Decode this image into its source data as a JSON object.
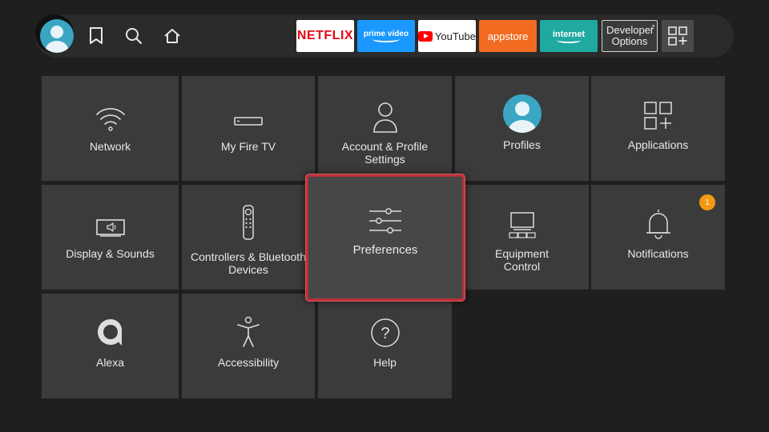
{
  "topbar": {
    "icons": [
      "profile-avatar",
      "bookmark-icon",
      "search-icon",
      "home-icon"
    ],
    "apps": {
      "netflix": "NETFLIX",
      "prime_video": "prime video",
      "youtube": "YouTube",
      "appstore": "appstore",
      "internet": "internet",
      "developer_options": "Developer Options"
    },
    "grid_icon": "apps-grid-icon",
    "settings_icon": "gear-icon"
  },
  "tiles": [
    {
      "label": "Network",
      "icon": "wifi-icon"
    },
    {
      "label": "My Fire TV",
      "icon": "fire-tv-stick-icon"
    },
    {
      "label": "Account & Profile\nSettings",
      "icon": "person-icon"
    },
    {
      "label": "Profiles",
      "icon": "profile-avatar-icon"
    },
    {
      "label": "Applications",
      "icon": "applications-icon"
    },
    {
      "label": "Display & Sounds",
      "icon": "tv-speaker-icon"
    },
    {
      "label": "Controllers & Bluetooth\nDevices",
      "icon": "remote-icon"
    },
    {
      "label": "Preferences",
      "icon": "sliders-icon",
      "focused": true
    },
    {
      "label": "Equipment\nControl",
      "icon": "equipment-icon"
    },
    {
      "label": "Notifications",
      "icon": "bell-icon",
      "badge": "1"
    },
    {
      "label": "Alexa",
      "icon": "alexa-icon"
    },
    {
      "label": "Accessibility",
      "icon": "accessibility-icon"
    },
    {
      "label": "Help",
      "icon": "help-icon"
    }
  ],
  "colors": {
    "background": "#1f1f1f",
    "tile": "#3b3b3b",
    "focus_border": "#b8323a",
    "badge": "#f39a12"
  }
}
